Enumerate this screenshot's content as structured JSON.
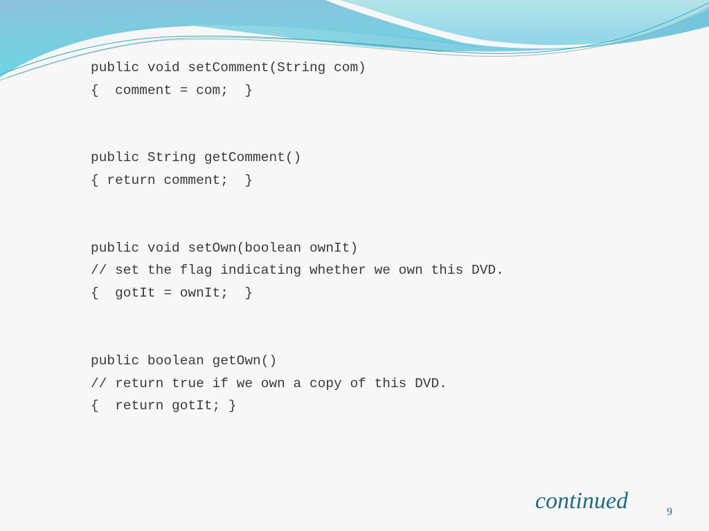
{
  "slide": {
    "code_groups": [
      {
        "lines": [
          "public void setComment(String com)",
          "{  comment = com;  }"
        ]
      },
      {
        "lines": [
          "public String getComment()",
          "{ return comment;  }"
        ]
      },
      {
        "lines": [
          "public void setOwn(boolean ownIt)",
          "// set the flag indicating whether we own this DVD.",
          "{  gotIt = ownIt;  }"
        ]
      },
      {
        "lines": [
          "public boolean getOwn()",
          "// return true if we own a copy of this DVD.",
          "{  return gotIt; }"
        ]
      }
    ],
    "footer": {
      "continued_label": "continued",
      "slide_number": "9"
    },
    "colors": {
      "wave_dark": "#7fc3dc",
      "wave_light": "#a8dfe8",
      "wave_cyan": "#6dd6e3",
      "accent_text": "#1f6a80",
      "code_text": "#3a3a3a"
    }
  }
}
